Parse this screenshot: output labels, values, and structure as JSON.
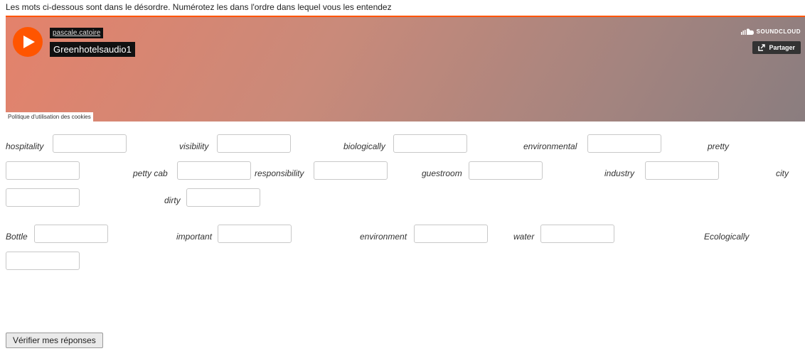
{
  "instructions": "Les mots ci-dessous sont dans le désordre. Numérotez les dans l'ordre dans lequel vous les entendez",
  "player": {
    "uploader": "pascale.catoire",
    "track_title": "Greenhotelsaudio1",
    "brand": "SOUNDCLOUD",
    "share_label": "Partager",
    "cookie_policy": "Politique d'utilisation des cookies",
    "accent_color": "#ff5500"
  },
  "words": [
    {
      "label": "hospitality"
    },
    {
      "label": "visibility"
    },
    {
      "label": "biologically"
    },
    {
      "label": "environmental"
    },
    {
      "label": "pretty"
    },
    {
      "label": "petty cab"
    },
    {
      "label": "responsibility"
    },
    {
      "label": "guestroom"
    },
    {
      "label": "industry"
    },
    {
      "label": "city"
    },
    {
      "label": "dirty"
    },
    {
      "label": "Bottle"
    },
    {
      "label": "important"
    },
    {
      "label": "environment"
    },
    {
      "label": "water"
    },
    {
      "label": "Ecologically"
    }
  ],
  "verify_button": "Vérifier mes réponses"
}
